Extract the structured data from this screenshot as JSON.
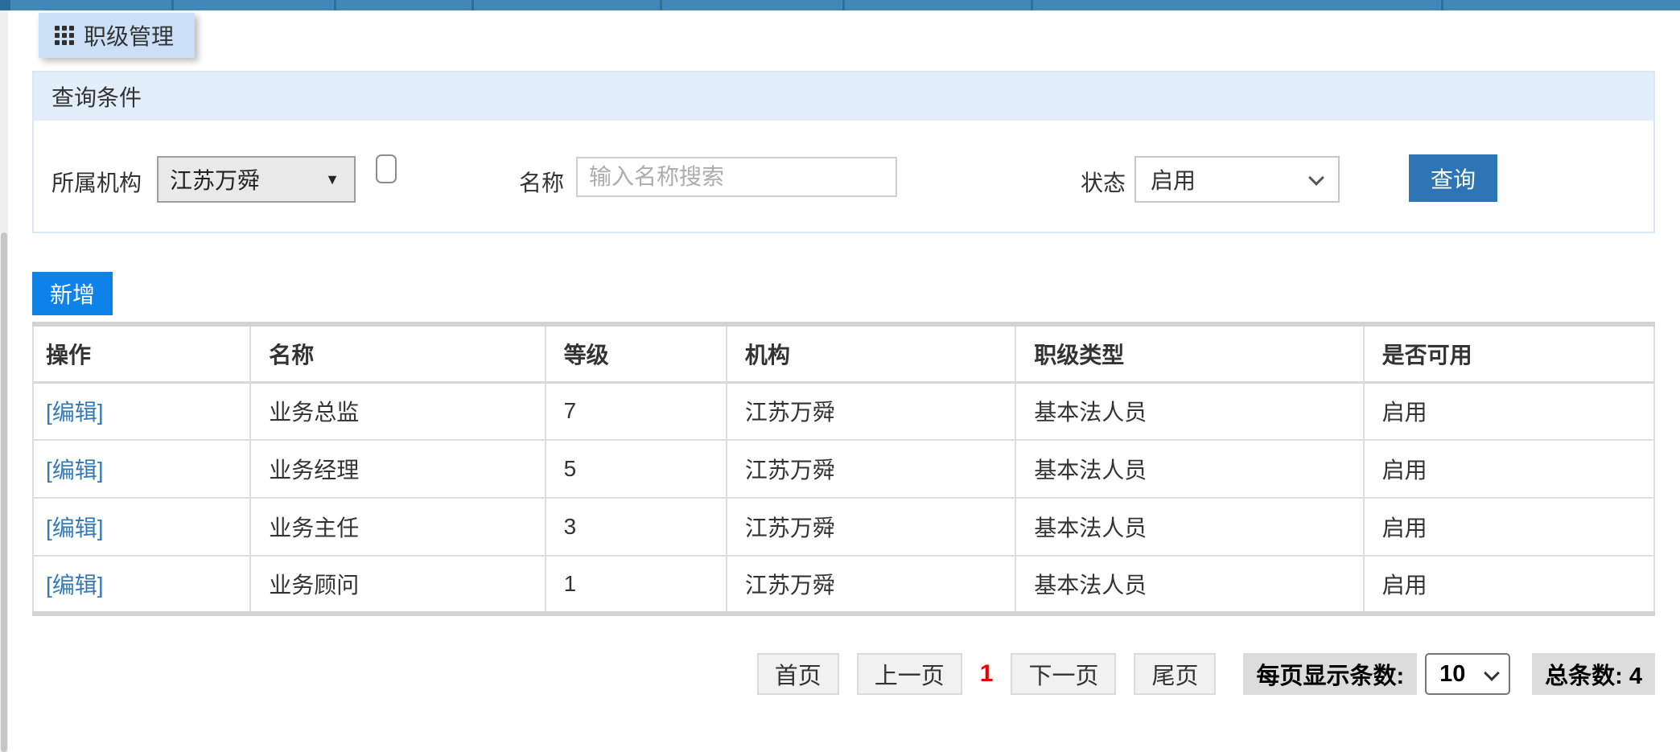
{
  "tab": {
    "label": "职级管理"
  },
  "query_panel": {
    "title": "查询条件",
    "org_label": "所属机构",
    "org_value": "江苏万舜",
    "name_label": "名称",
    "name_placeholder": "输入名称搜索",
    "name_value": "",
    "status_label": "状态",
    "status_value": "启用",
    "search_button": "查询"
  },
  "toolbar": {
    "add_button": "新增"
  },
  "table": {
    "columns": [
      "操作",
      "名称",
      "等级",
      "机构",
      "职级类型",
      "是否可用"
    ],
    "edit_label": "[编辑]",
    "rows": [
      {
        "name": "业务总监",
        "level": "7",
        "org": "江苏万舜",
        "type": "基本法人员",
        "enabled": "启用"
      },
      {
        "name": "业务经理",
        "level": "5",
        "org": "江苏万舜",
        "type": "基本法人员",
        "enabled": "启用"
      },
      {
        "name": "业务主任",
        "level": "3",
        "org": "江苏万舜",
        "type": "基本法人员",
        "enabled": "启用"
      },
      {
        "name": "业务顾问",
        "level": "1",
        "org": "江苏万舜",
        "type": "基本法人员",
        "enabled": "启用"
      }
    ]
  },
  "pagination": {
    "first": "首页",
    "prev": "上一页",
    "current_page": "1",
    "next": "下一页",
    "last": "尾页",
    "page_size_label": "每页显示条数:",
    "page_size": "10",
    "total_label": "总条数: 4"
  },
  "colors": {
    "topbar_blue": "#4187b7",
    "tab_bg": "#cbe0f7",
    "panel_band_bg": "#e3eefb",
    "query_button_blue": "#2d75b5",
    "add_button_blue": "#0d82e8",
    "link_blue": "#337ab7",
    "current_page_red": "#e60000"
  }
}
